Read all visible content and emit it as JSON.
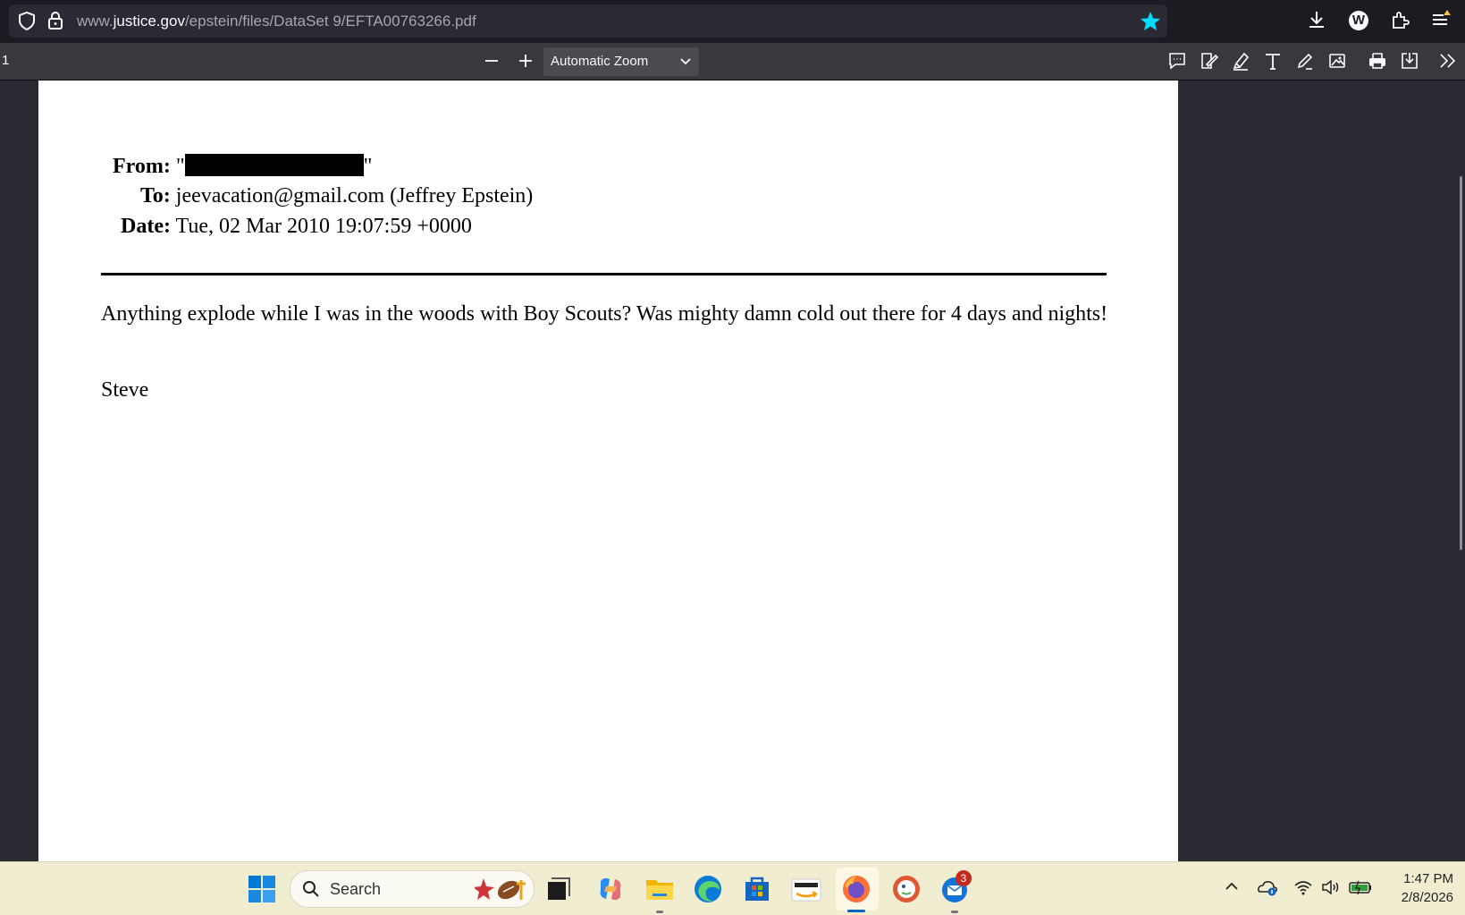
{
  "address_bar": {
    "url_domain_prefix": "www.",
    "url_domain": "justice.gov",
    "url_path": "/epstein/files/DataSet 9/EFTA00763266.pdf",
    "icons": [
      "shield-icon",
      "lock-icon",
      "bookmark-star-icon",
      "download-icon",
      "account-icon",
      "extensions-icon",
      "menu-icon"
    ],
    "account_initial": "W",
    "accent_color": "#00ddff"
  },
  "pdf_toolbar": {
    "page_number": "1",
    "zoom_value": "Automatic Zoom",
    "icons": [
      "zoom-out-icon",
      "zoom-in-icon",
      "chevron-down-icon",
      "comment-icon",
      "signature-icon",
      "highlight-icon",
      "text-icon",
      "draw-icon",
      "image-icon",
      "print-icon",
      "save-icon",
      "more-tools-icon"
    ]
  },
  "document": {
    "from_label": "From:",
    "from_value_open": "\"",
    "from_value_close": "\"",
    "to_label": "To:",
    "to_value": "jeevacation@gmail.com (Jeffrey Epstein)",
    "date_label": "Date:",
    "date_value": "Tue, 02 Mar 2010 19:07:59 +0000",
    "body": "Anything explode while I was in the woods with Boy Scouts?  Was mighty damn cold out there for 4 days and nights!",
    "signature": "Steve"
  },
  "taskbar": {
    "search_placeholder": "Search",
    "apps": [
      "windows-start-icon",
      "widgets-icon",
      "task-view-icon",
      "copilot-icon",
      "file-explorer-icon",
      "edge-icon",
      "microsoft-store-icon",
      "amazon-icon",
      "firefox-icon",
      "duckduckgo-icon",
      "thunderbird-icon"
    ],
    "notification_count": "3",
    "time": "1:47 PM",
    "date": "2/8/2026",
    "tray_icons": [
      "chevron-up-icon",
      "onedrive-icon",
      "wifi-icon",
      "volume-icon",
      "battery-icon"
    ]
  }
}
